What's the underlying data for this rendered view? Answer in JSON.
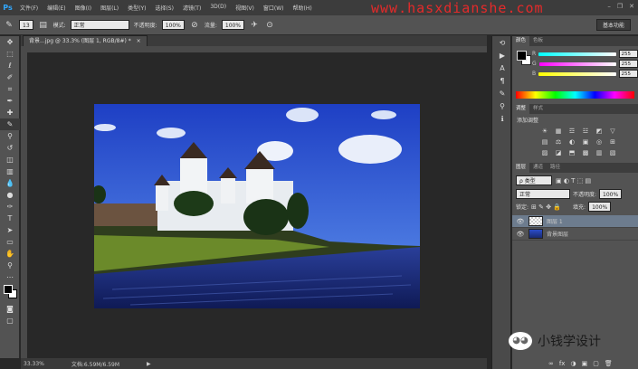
{
  "app": {
    "logo": "Ps",
    "watermark": "www.hasxdianshe.com",
    "window_controls": [
      "–",
      "❐",
      "✕"
    ]
  },
  "menu": [
    "文件(F)",
    "编辑(E)",
    "图像(I)",
    "图层(L)",
    "类型(Y)",
    "选择(S)",
    "滤镜(T)",
    "3D(D)",
    "视图(V)",
    "窗口(W)",
    "帮助(H)"
  ],
  "options": {
    "brush_size": "13",
    "mode_label": "模式:",
    "mode_value": "正常",
    "opacity_label": "不透明度:",
    "opacity_value": "100%",
    "flow_label": "流量:",
    "flow_value": "100%",
    "workspace": "基本功能"
  },
  "document": {
    "tab_title": "背景...jpg @ 33.3% (图层 1, RGB/8#) *",
    "close": "×"
  },
  "status": {
    "zoom": "33.33%",
    "doc_info": "文档:6.59M/6.59M",
    "arrow": "▶"
  },
  "color_panel": {
    "tabs": [
      "颜色",
      "色板"
    ],
    "channels": [
      {
        "label": "R",
        "value": "255",
        "gradient": "linear-gradient(90deg,#00ffff,#ffffff)"
      },
      {
        "label": "G",
        "value": "255",
        "gradient": "linear-gradient(90deg,#ff00ff,#ffffff)"
      },
      {
        "label": "B",
        "value": "255",
        "gradient": "linear-gradient(90deg,#ffff00,#ffffff)"
      }
    ]
  },
  "adjust_panel": {
    "tabs": [
      "调整",
      "样式"
    ],
    "title": "添加调整",
    "icons": [
      "☀",
      "▦",
      "☲",
      "☳",
      "◩",
      "▽",
      "▤",
      "⚖",
      "◐",
      "▣",
      "◎",
      "⊞",
      "▨",
      "◪",
      "⬒",
      "▩",
      "▥",
      "▧"
    ]
  },
  "layers_panel": {
    "tabs": [
      "图层",
      "通道",
      "路径"
    ],
    "kind_label": "ρ 类型",
    "blend_mode": "正常",
    "opacity_label": "不透明度:",
    "opacity_value": "100%",
    "lock_label": "锁定:",
    "fill_label": "填充:",
    "fill_value": "100%",
    "layers": [
      {
        "name": "图层 1",
        "selected": true
      },
      {
        "name": "背景图层",
        "selected": false
      }
    ],
    "footer_icons": [
      "∞",
      "fx",
      "◑",
      "▣",
      "▢",
      "🗑"
    ]
  },
  "brand": {
    "name": "小钱学设计"
  },
  "colors": {
    "accent": "#31a8ff",
    "panel": "#535353",
    "canvas_bg": "#282828"
  }
}
